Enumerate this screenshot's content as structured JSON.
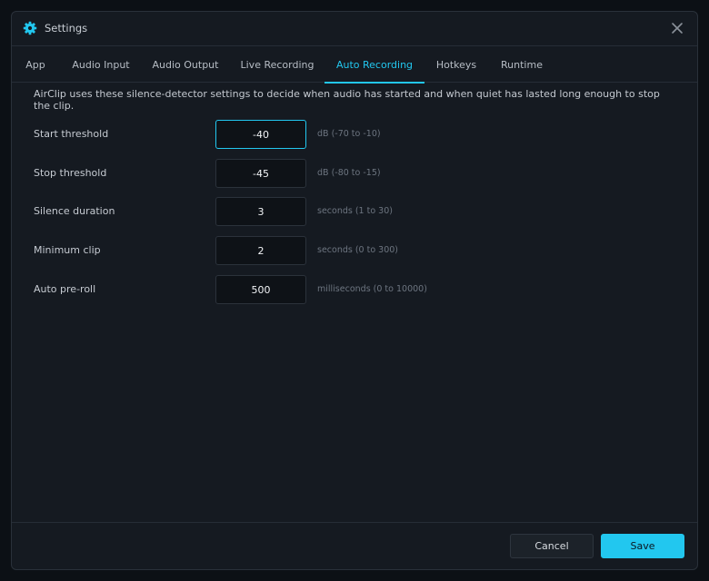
{
  "window": {
    "title": "Settings",
    "icon": "gear-icon"
  },
  "tabs": [
    {
      "label": "App",
      "active": false
    },
    {
      "label": "Audio Input",
      "active": false
    },
    {
      "label": "Audio Output",
      "active": false
    },
    {
      "label": "Live Recording",
      "active": false
    },
    {
      "label": "Auto Recording",
      "active": true
    },
    {
      "label": "Hotkeys",
      "active": false
    },
    {
      "label": "Runtime",
      "active": false
    }
  ],
  "auto_recording": {
    "description": "AirClip uses these silence-detector settings to decide when audio has started and when quiet has lasted long enough to stop the clip.",
    "fields": [
      {
        "label": "Start threshold",
        "value": "-40",
        "hint": "dB (-70 to -10)",
        "focused": true
      },
      {
        "label": "Stop threshold",
        "value": "-45",
        "hint": "dB (-80 to -15)",
        "focused": false
      },
      {
        "label": "Silence duration",
        "value": "3",
        "hint": "seconds (1 to 30)",
        "focused": false
      },
      {
        "label": "Minimum clip",
        "value": "2",
        "hint": "seconds (0 to 300)",
        "focused": false
      },
      {
        "label": "Auto pre-roll",
        "value": "500",
        "hint": "milliseconds (0 to 10000)",
        "focused": false
      }
    ]
  },
  "footer": {
    "cancel_label": "Cancel",
    "save_label": "Save"
  },
  "colors": {
    "accent": "#22c7ef",
    "window_bg": "#151a21",
    "input_bg": "#0e1217"
  }
}
